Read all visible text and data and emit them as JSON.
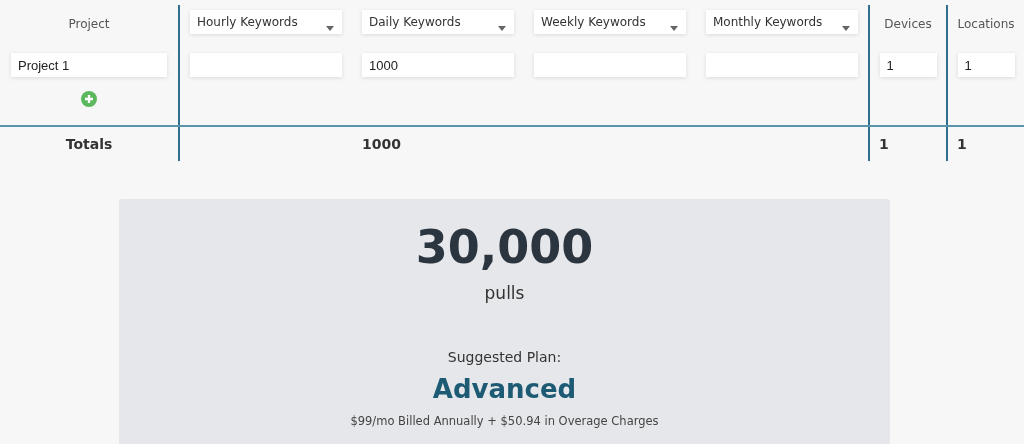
{
  "table": {
    "project_header": "Project",
    "keyword_selects": [
      {
        "label": "Hourly Keywords"
      },
      {
        "label": "Daily Keywords",
        "project_1_value": "1000",
        "total": "1000"
      },
      {
        "label": "Weekly Keywords"
      },
      {
        "label": "Monthly Keywords"
      }
    ],
    "devices_header": "Devices",
    "locations_header": "Locations",
    "rows": [
      {
        "project": "Project 1",
        "devices": "1",
        "locations": "1"
      }
    ],
    "totals": {
      "label": "Totals",
      "devices": "1",
      "locations": "1"
    }
  },
  "summary": {
    "pulls": "30,000",
    "unit": "pulls",
    "plan_label": "Suggested Plan:",
    "plan": "Advanced",
    "price": "$99/mo Billed Annually + $50.94 in Overage Charges"
  }
}
